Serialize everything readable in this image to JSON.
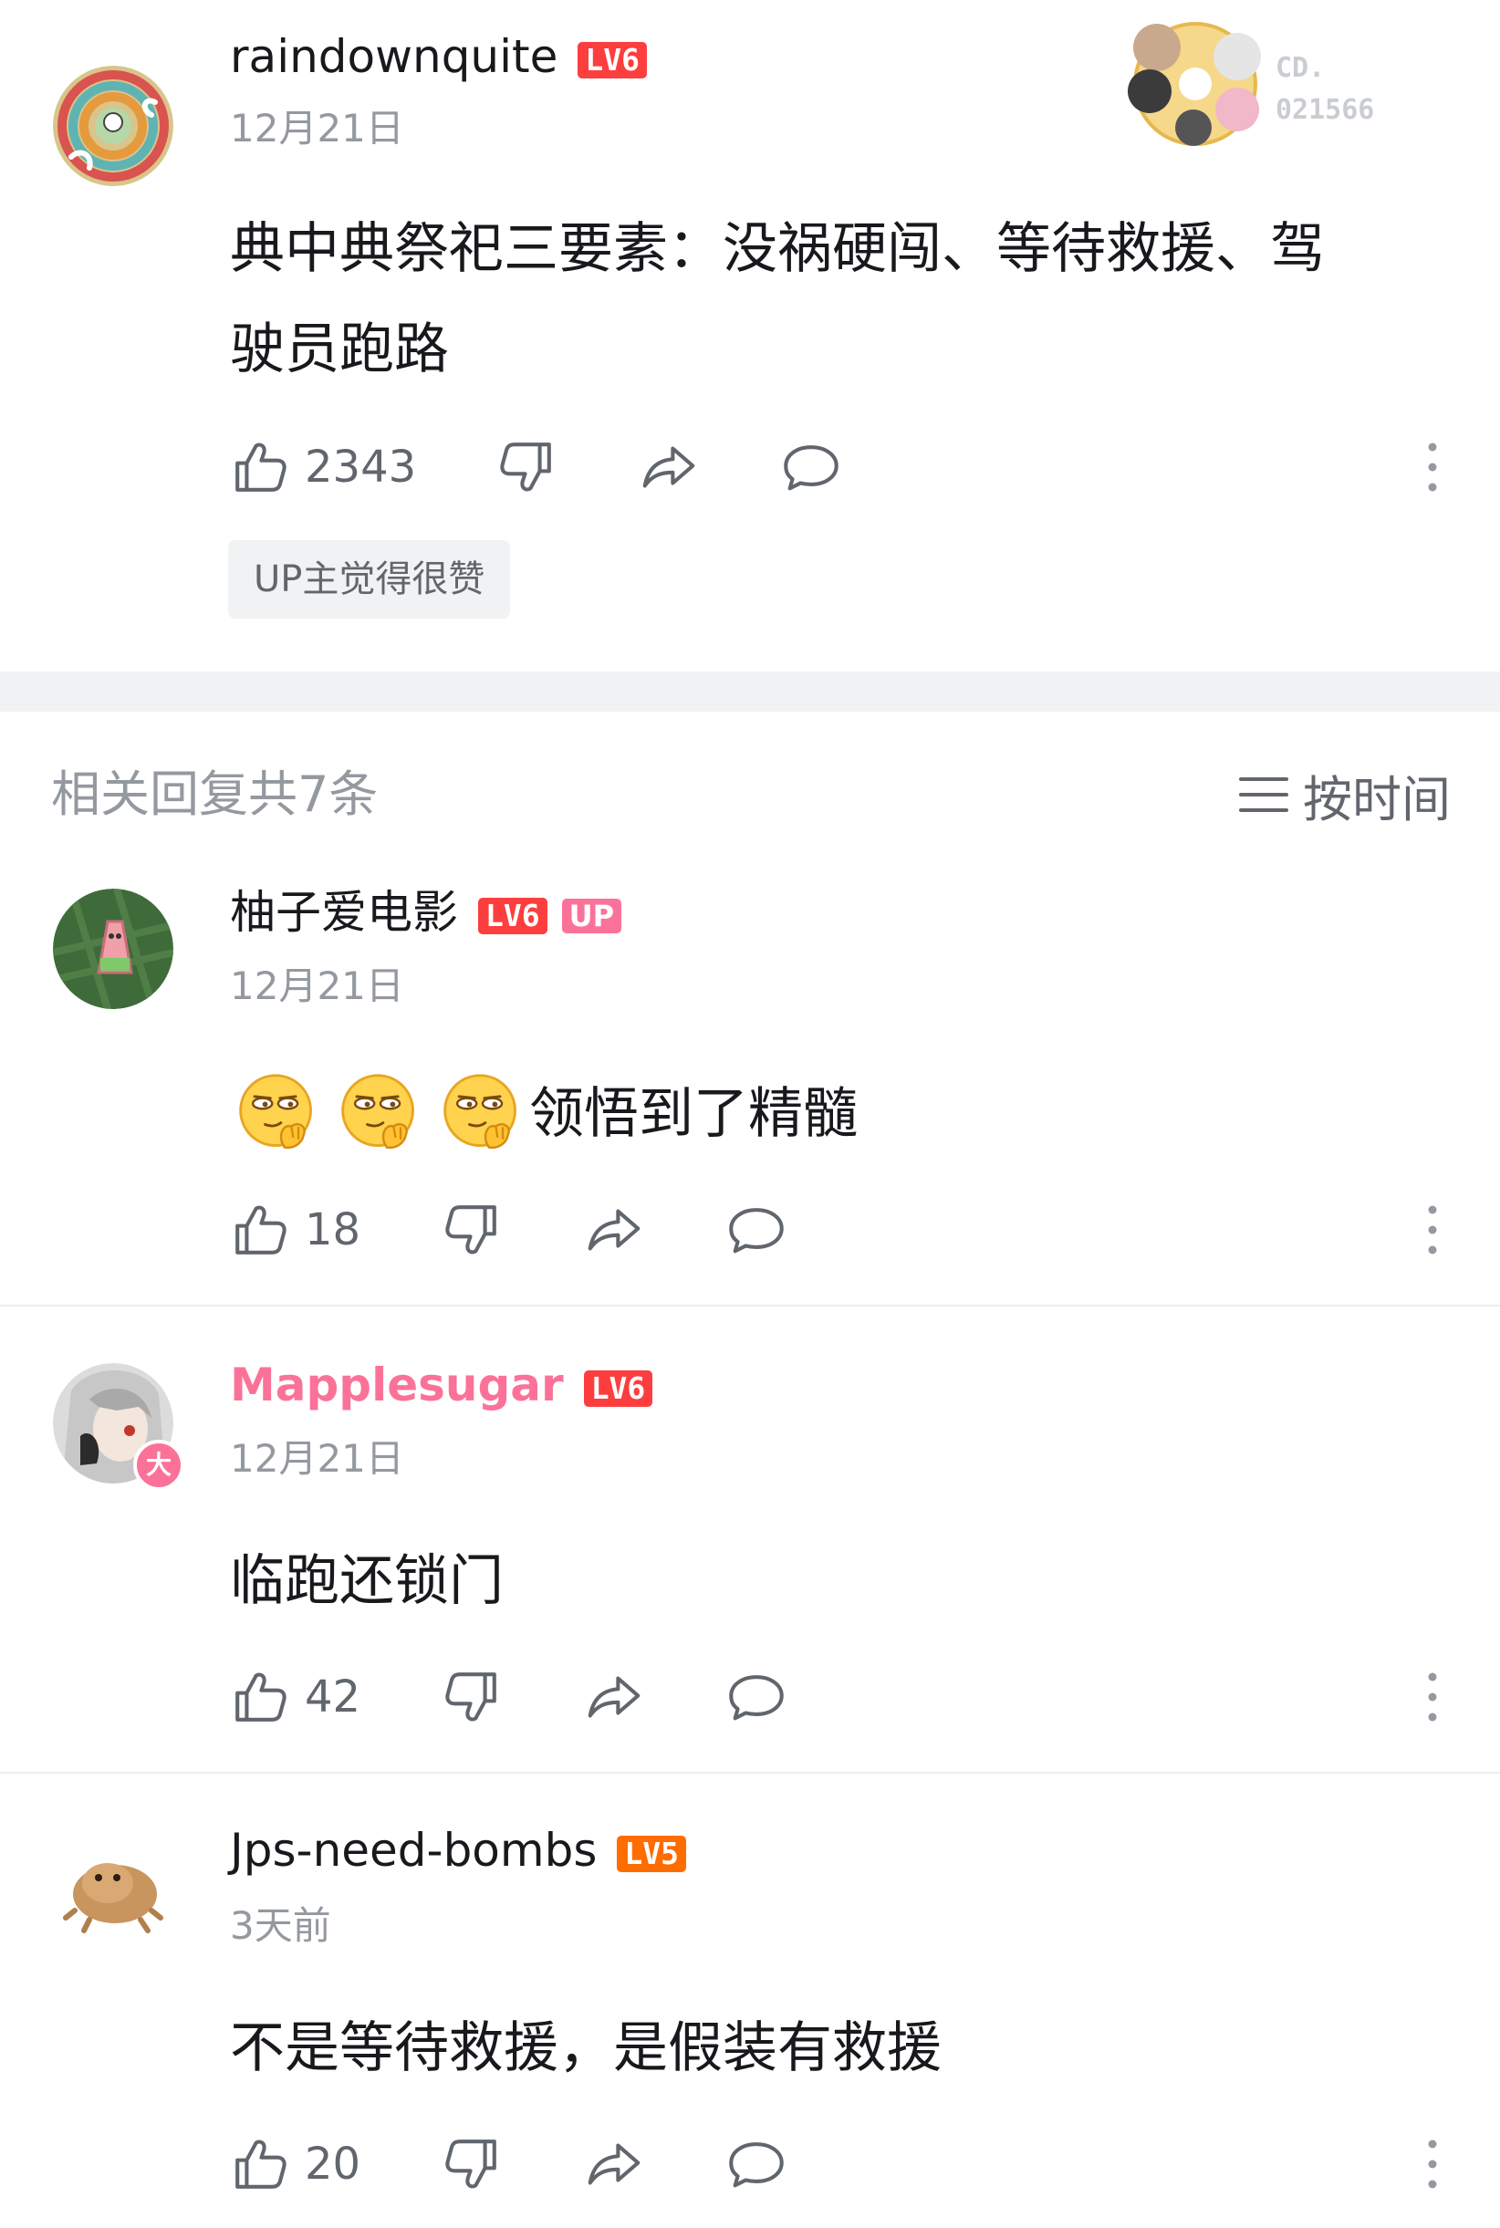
{
  "main_comment": {
    "username": "raindownquite",
    "level": "LV6",
    "date": "12月21日",
    "text_line1": "典中典祭祀三要素：没祸硬闯、等待救援、驾",
    "text_line2": "驶员跑路",
    "likes": "2343",
    "up_tag": "UP主觉得很赞",
    "fan_badge": {
      "line1": "CD.",
      "line2": "021566"
    }
  },
  "replies_header": {
    "title": "相关回复共7条",
    "sort_label": "按时间"
  },
  "replies": [
    {
      "username": "柚子爱电影",
      "level": "LV6",
      "up_badge": "UP",
      "date": "12月21日",
      "text": "领悟到了精髓",
      "emoji_count": 3,
      "likes": "18"
    },
    {
      "username": "Mapplesugar",
      "level": "LV6",
      "vip_badge": "大",
      "date": "12月21日",
      "text": "临跑还锁门",
      "likes": "42"
    },
    {
      "username": "Jps-need-bombs",
      "level": "LV5",
      "date": "3天前",
      "text": "不是等待救援，是假装有救援",
      "likes": "20"
    }
  ],
  "colors": {
    "vip_pink": "#fb7299",
    "lv6": "#fd3e3e",
    "lv5": "#ff6c00",
    "muted": "#9499a0"
  }
}
